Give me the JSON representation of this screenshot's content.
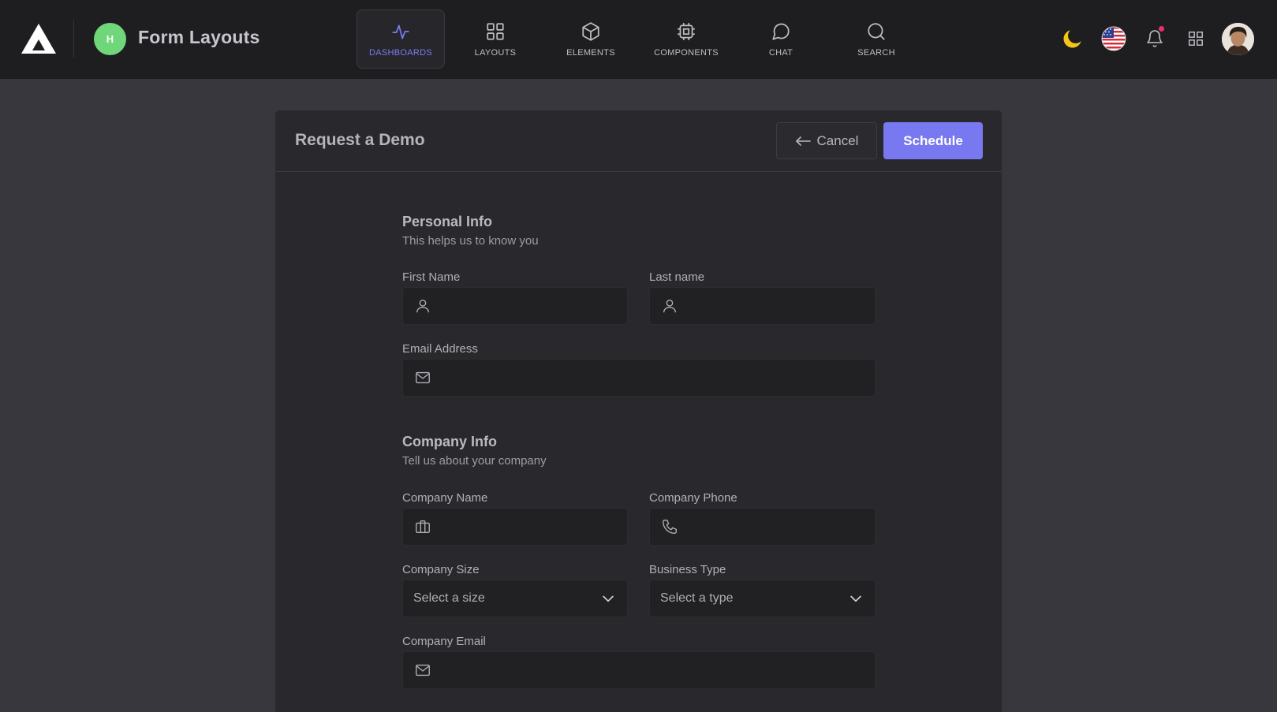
{
  "header": {
    "logo_icon": "triangle-logo-icon",
    "workspace_initial": "H",
    "workspace_color": "#6fd679",
    "page_title": "Form Layouts"
  },
  "nav": {
    "tabs": [
      {
        "label": "Dashboards",
        "icon": "activity-icon",
        "active": true
      },
      {
        "label": "Layouts",
        "icon": "grid-icon",
        "active": false
      },
      {
        "label": "Elements",
        "icon": "box-icon",
        "active": false
      },
      {
        "label": "Components",
        "icon": "cpu-icon",
        "active": false
      },
      {
        "label": "Chat",
        "icon": "message-circle-icon",
        "active": false
      },
      {
        "label": "Search",
        "icon": "search-icon",
        "active": false
      }
    ],
    "accent_color": "#7b7bf5"
  },
  "toolbar_right": {
    "theme_icon": "moon-icon",
    "language_icon": "us-flag-icon",
    "notifications_icon": "bell-icon",
    "apps_icon": "apps-grid-icon",
    "avatar_icon": "user-avatar"
  },
  "card": {
    "title": "Request a Demo",
    "cancel_label": "Cancel",
    "schedule_label": "Schedule",
    "schedule_color": "#7878f0"
  },
  "personal": {
    "title": "Personal Info",
    "subtitle": "This helps us to know you",
    "first_name_label": "First Name",
    "first_name_value": "",
    "last_name_label": "Last name",
    "last_name_value": "",
    "email_label": "Email Address",
    "email_value": ""
  },
  "company": {
    "title": "Company Info",
    "subtitle": "Tell us about your company",
    "name_label": "Company Name",
    "name_value": "",
    "phone_label": "Company Phone",
    "phone_value": "",
    "size_label": "Company Size",
    "size_selected": "Select a size",
    "type_label": "Business Type",
    "type_selected": "Select a type",
    "email_label": "Company Email",
    "email_value": ""
  }
}
